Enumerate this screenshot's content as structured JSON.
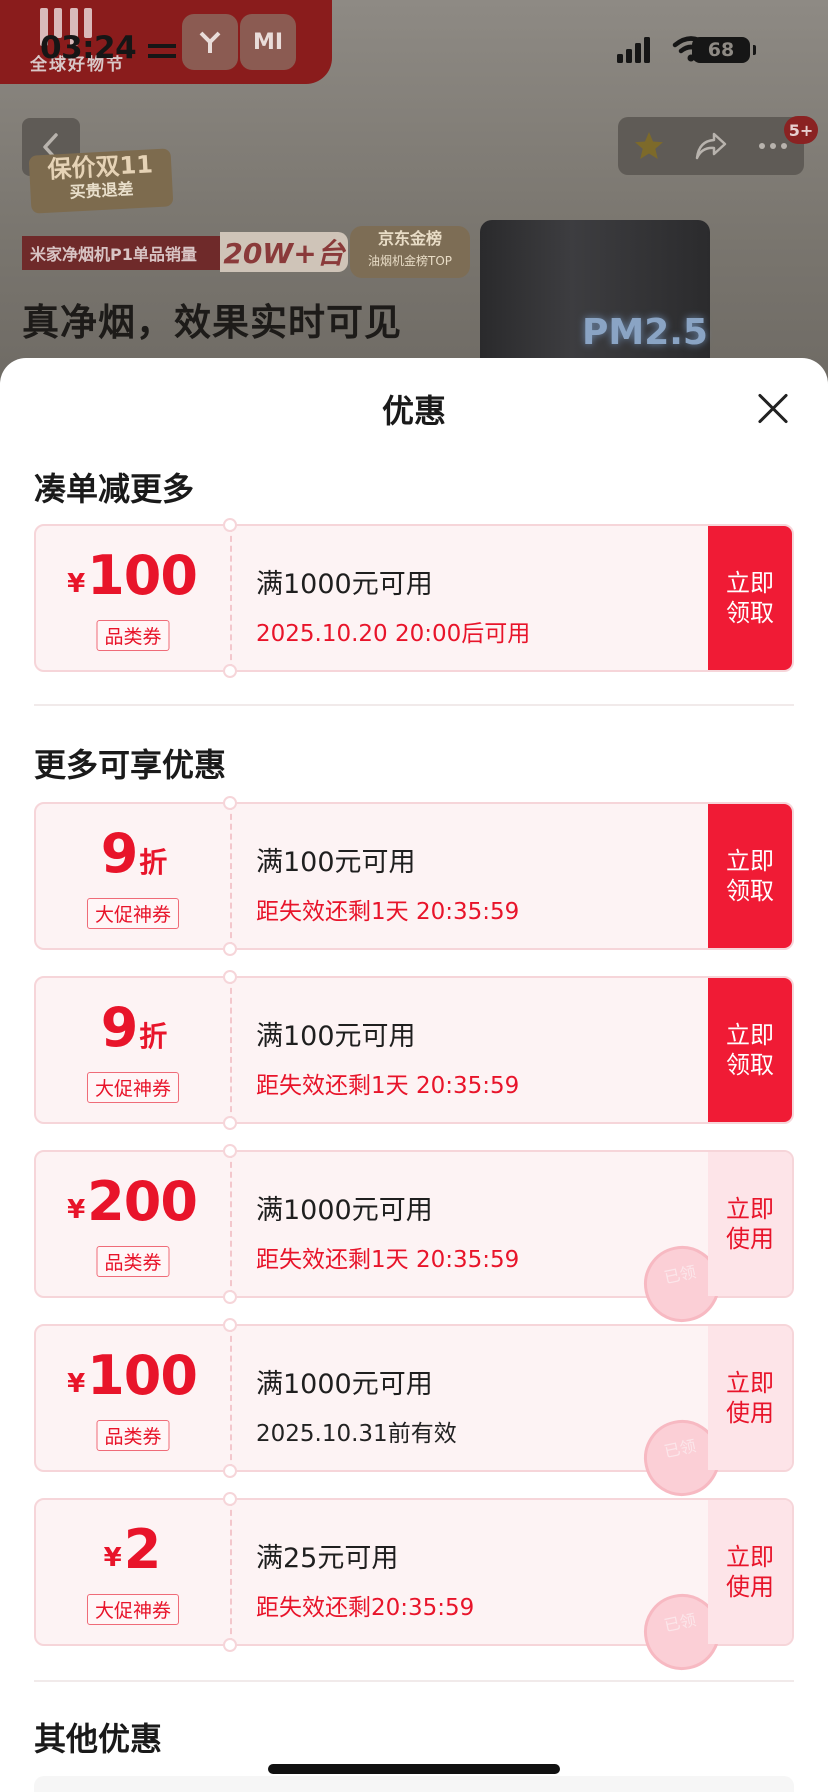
{
  "status_bar": {
    "time": "03:24",
    "battery": "68"
  },
  "product_page": {
    "brand_label": "全球好物节",
    "brand_mark": "MI",
    "message_badge": "5+",
    "promo_badge_main": "保价双11",
    "promo_badge_sub": "买贵退差",
    "sales_tag": "米家净烟机P1单品销量",
    "sales_num": "20W+台",
    "gold_title": "京东金榜",
    "gold_sub": "油烟机金榜TOP",
    "headline": "真净烟，效果实时可见",
    "product_label": "PM2.5"
  },
  "sheet": {
    "title": "优惠",
    "sections": {
      "more_orders": "凑单减更多",
      "more_discounts": "更多可享优惠",
      "other": "其他优惠"
    },
    "coupons": [
      {
        "currency": "¥",
        "value": "100",
        "unit": "",
        "tag": "品类券",
        "main": "满1000元可用",
        "sub": "2025.10.20 20:00后可用",
        "button": "立即领取",
        "state": "get"
      },
      {
        "currency": "",
        "value": "9",
        "unit": "折",
        "tag": "大促神券",
        "main": "满100元可用",
        "sub": "距失效还剩1天 20:35:59",
        "button": "立即领取",
        "state": "get"
      },
      {
        "currency": "",
        "value": "9",
        "unit": "折",
        "tag": "大促神券",
        "main": "满100元可用",
        "sub": "距失效还剩1天 20:35:59",
        "button": "立即领取",
        "state": "get"
      },
      {
        "currency": "¥",
        "value": "200",
        "unit": "",
        "tag": "品类券",
        "main": "满1000元可用",
        "sub": "距失效还剩1天 20:35:59",
        "button": "立即使用",
        "state": "use",
        "stamp": "已领"
      },
      {
        "currency": "¥",
        "value": "100",
        "unit": "",
        "tag": "品类券",
        "main": "满1000元可用",
        "sub": "2025.10.31前有效",
        "button": "立即使用",
        "state": "use",
        "stamp": "已领"
      },
      {
        "currency": "¥",
        "value": "2",
        "unit": "",
        "tag": "大促神券",
        "main": "满25元可用",
        "sub": "距失效还剩20:35:59",
        "button": "立即使用",
        "state": "use",
        "stamp": "已领"
      }
    ]
  },
  "colors": {
    "accent": "#f01b35",
    "price": "#e8142a",
    "coupon_bg": "#fdf3f4",
    "use_button_bg": "#fde4e8"
  }
}
